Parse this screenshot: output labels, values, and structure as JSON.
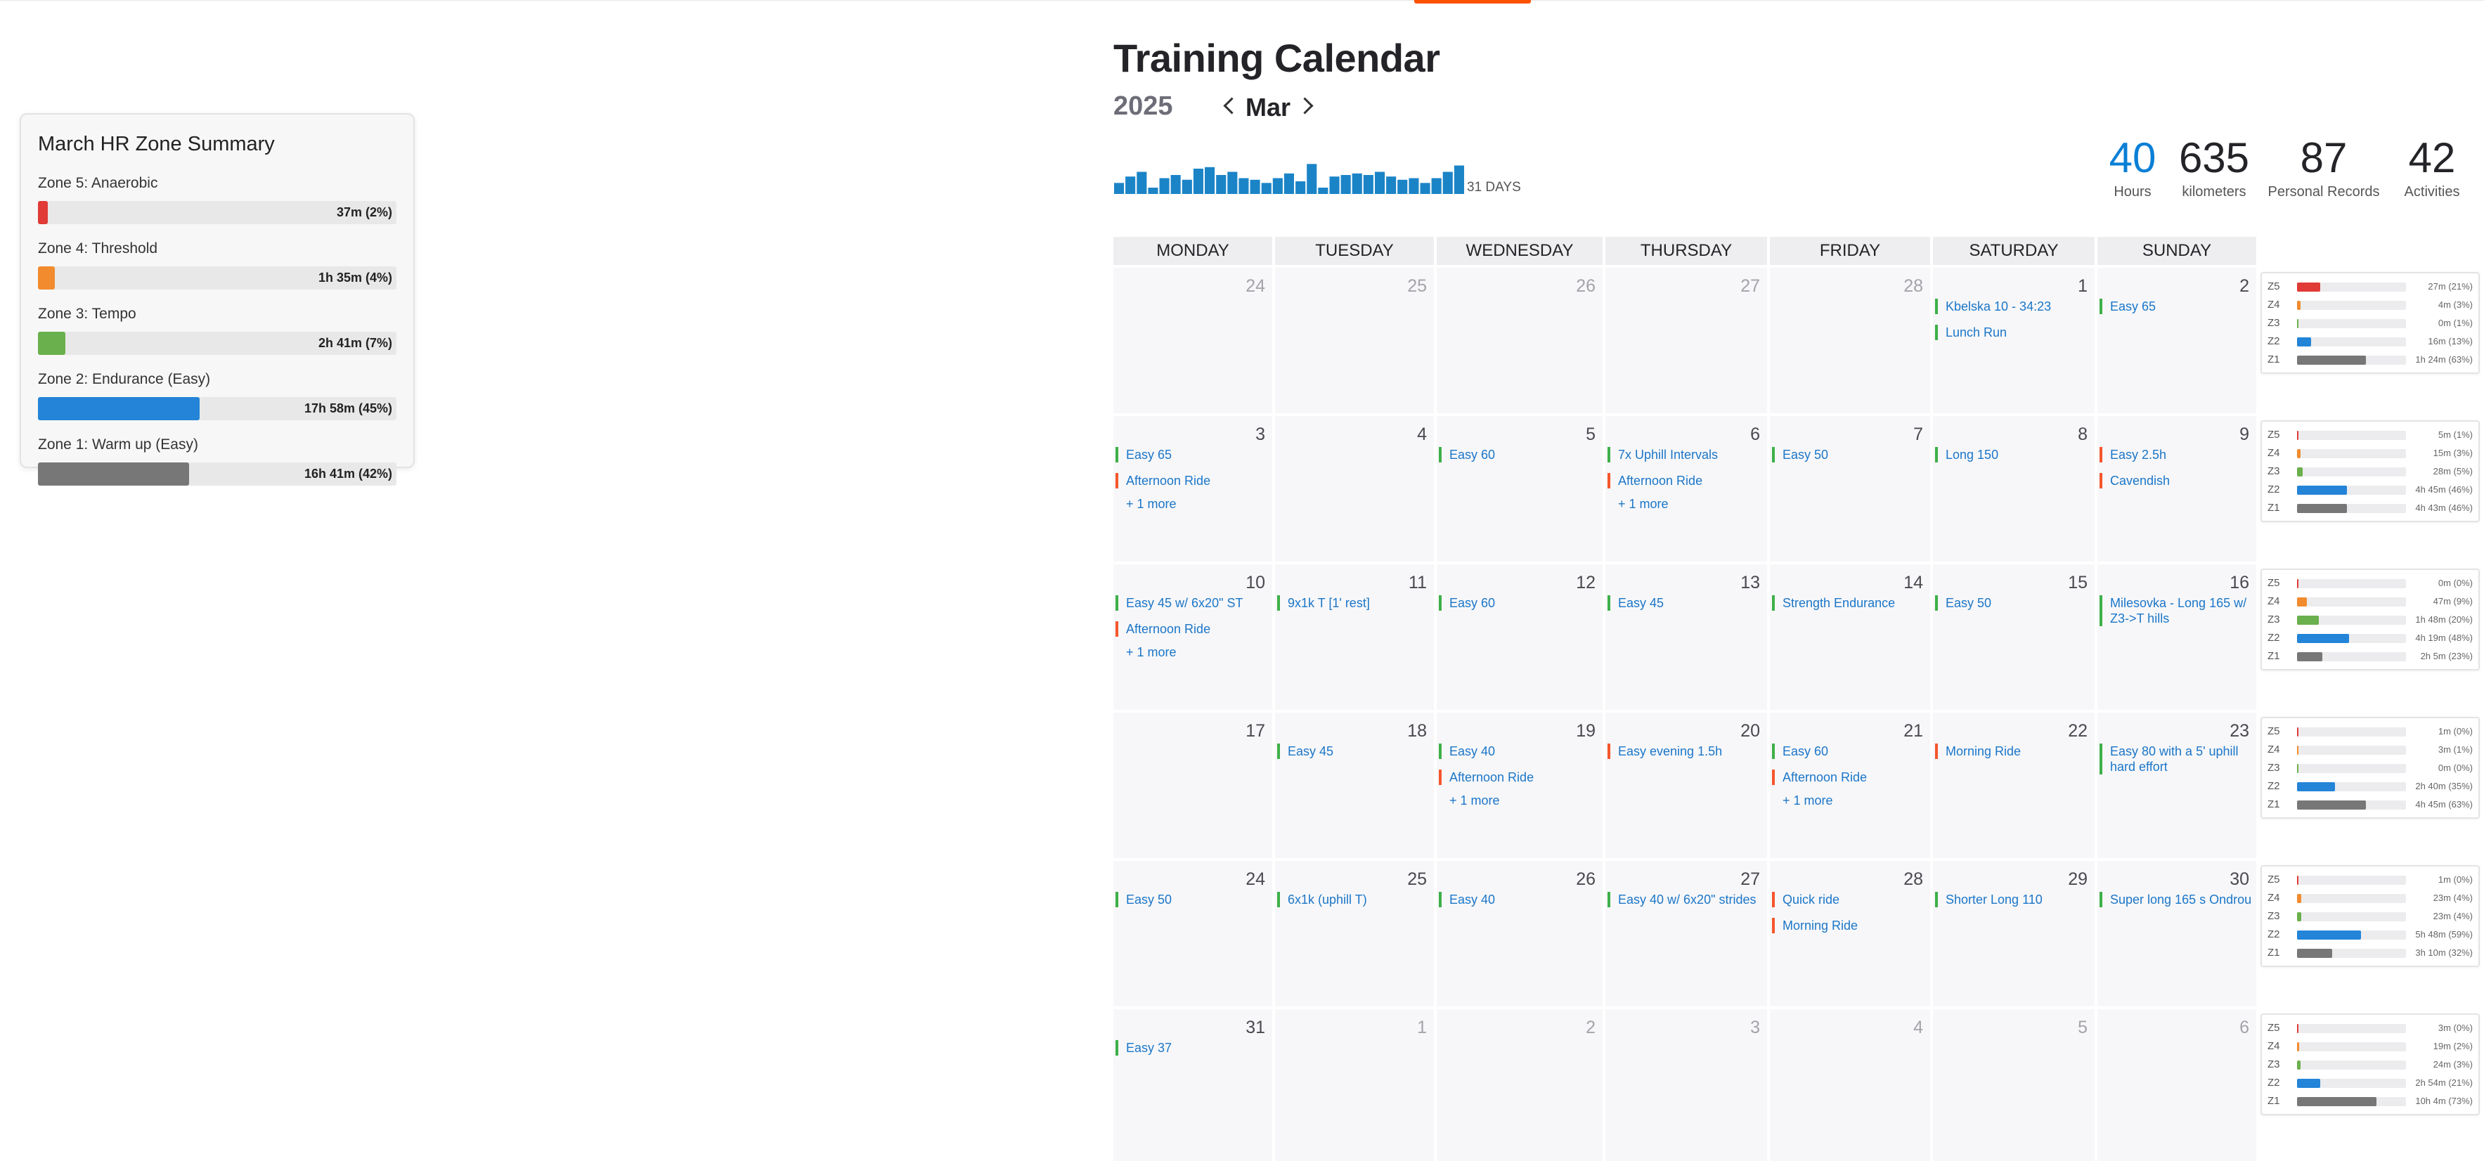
{
  "zone_summary": {
    "title": "March HR Zone Summary",
    "zones": [
      {
        "label": "Zone 5: Anaerobic",
        "value": "37m (2%)",
        "fraction": 0.02,
        "color": "#e03b36"
      },
      {
        "label": "Zone 4: Threshold",
        "value": "1h 35m (4%)",
        "fraction": 0.04,
        "color": "#f28b2e"
      },
      {
        "label": "Zone 3: Tempo",
        "value": "2h 41m (7%)",
        "fraction": 0.07,
        "color": "#6ab04c"
      },
      {
        "label": "Zone 2: Endurance (Easy)",
        "value": "17h 58m (45%)",
        "fraction": 0.45,
        "color": "#2384d8"
      },
      {
        "label": "Zone 1: Warm up (Easy)",
        "value": "16h 41m (42%)",
        "fraction": 0.42,
        "color": "#777777"
      }
    ]
  },
  "header": {
    "title": "Training Calendar",
    "year": "2025",
    "month": "Mar",
    "days_label": "31 DAYS",
    "spark_color": "#1b84c7",
    "spark_values": [
      0.35,
      0.55,
      0.7,
      0.2,
      0.5,
      0.6,
      0.45,
      0.8,
      0.85,
      0.6,
      0.7,
      0.5,
      0.45,
      0.35,
      0.5,
      0.65,
      0.4,
      0.95,
      0.2,
      0.55,
      0.6,
      0.65,
      0.6,
      0.7,
      0.55,
      0.45,
      0.5,
      0.35,
      0.5,
      0.7,
      0.9
    ]
  },
  "stats": [
    {
      "value": "40",
      "label": "Hours"
    },
    {
      "value": "635",
      "label": "kilometers"
    },
    {
      "value": "87",
      "label": "Personal Records"
    },
    {
      "value": "42",
      "label": "Activities"
    }
  ],
  "calendar": {
    "weekdays": [
      "MONDAY",
      "TUESDAY",
      "WEDNESDAY",
      "THURSDAY",
      "FRIDAY",
      "SATURDAY",
      "SUNDAY"
    ],
    "weeks": [
      {
        "days": [
          {
            "num": "24",
            "other": true,
            "acts": []
          },
          {
            "num": "25",
            "other": true,
            "acts": []
          },
          {
            "num": "26",
            "other": true,
            "acts": []
          },
          {
            "num": "27",
            "other": true,
            "acts": []
          },
          {
            "num": "28",
            "other": true,
            "acts": []
          },
          {
            "num": "1",
            "acts": [
              {
                "t": "Kbelska 10 - 34:23",
                "c": "green"
              },
              {
                "t": "Lunch Run",
                "c": "green"
              }
            ]
          },
          {
            "num": "2",
            "acts": [
              {
                "t": "Easy 65",
                "c": "green"
              }
            ]
          }
        ]
      },
      {
        "days": [
          {
            "num": "3",
            "acts": [
              {
                "t": "Easy 65",
                "c": "green"
              },
              {
                "t": "Afternoon Ride",
                "c": "orange"
              }
            ],
            "more": "+ 1 more"
          },
          {
            "num": "4",
            "acts": []
          },
          {
            "num": "5",
            "acts": [
              {
                "t": "Easy 60",
                "c": "green"
              }
            ]
          },
          {
            "num": "6",
            "acts": [
              {
                "t": "7x Uphill Intervals",
                "c": "green"
              },
              {
                "t": "Afternoon Ride",
                "c": "orange"
              }
            ],
            "more": "+ 1 more"
          },
          {
            "num": "7",
            "acts": [
              {
                "t": "Easy 50",
                "c": "green"
              }
            ]
          },
          {
            "num": "8",
            "acts": [
              {
                "t": "Long 150",
                "c": "green"
              }
            ]
          },
          {
            "num": "9",
            "acts": [
              {
                "t": "Easy 2.5h",
                "c": "orange"
              },
              {
                "t": "Cavendish",
                "c": "orange"
              }
            ]
          }
        ]
      },
      {
        "days": [
          {
            "num": "10",
            "acts": [
              {
                "t": "Easy 45 w/ 6x20\" ST",
                "c": "green"
              },
              {
                "t": "Afternoon Ride",
                "c": "orange"
              }
            ],
            "more": "+ 1 more"
          },
          {
            "num": "11",
            "acts": [
              {
                "t": "9x1k T [1' rest]",
                "c": "green"
              }
            ]
          },
          {
            "num": "12",
            "acts": [
              {
                "t": "Easy 60",
                "c": "green"
              }
            ]
          },
          {
            "num": "13",
            "acts": [
              {
                "t": "Easy 45",
                "c": "green"
              }
            ]
          },
          {
            "num": "14",
            "acts": [
              {
                "t": "Strength Endurance",
                "c": "green"
              }
            ]
          },
          {
            "num": "15",
            "acts": [
              {
                "t": "Easy 50",
                "c": "green"
              }
            ]
          },
          {
            "num": "16",
            "acts": [
              {
                "t": "Milesovka - Long 165 w/ Z3->T hills",
                "c": "green",
                "two": true
              }
            ]
          }
        ]
      },
      {
        "days": [
          {
            "num": "17",
            "acts": []
          },
          {
            "num": "18",
            "acts": [
              {
                "t": "Easy 45",
                "c": "green"
              }
            ]
          },
          {
            "num": "19",
            "acts": [
              {
                "t": "Easy 40",
                "c": "green"
              },
              {
                "t": "Afternoon Ride",
                "c": "orange"
              }
            ],
            "more": "+ 1 more"
          },
          {
            "num": "20",
            "acts": [
              {
                "t": "Easy evening 1.5h",
                "c": "orange"
              }
            ]
          },
          {
            "num": "21",
            "acts": [
              {
                "t": "Easy 60",
                "c": "green"
              },
              {
                "t": "Afternoon Ride",
                "c": "orange"
              }
            ],
            "more": "+ 1 more"
          },
          {
            "num": "22",
            "acts": [
              {
                "t": "Morning Ride",
                "c": "orange"
              }
            ]
          },
          {
            "num": "23",
            "acts": [
              {
                "t": "Easy 80 with a 5' uphill hard effort",
                "c": "green",
                "two": true
              }
            ]
          }
        ]
      },
      {
        "days": [
          {
            "num": "24",
            "acts": [
              {
                "t": "Easy 50",
                "c": "green"
              }
            ]
          },
          {
            "num": "25",
            "acts": [
              {
                "t": "6x1k (uphill T)",
                "c": "green"
              }
            ]
          },
          {
            "num": "26",
            "acts": [
              {
                "t": "Easy 40",
                "c": "green"
              }
            ]
          },
          {
            "num": "27",
            "acts": [
              {
                "t": "Easy 40 w/ 6x20\" strides",
                "c": "green"
              }
            ]
          },
          {
            "num": "28",
            "acts": [
              {
                "t": "Quick ride",
                "c": "orange"
              },
              {
                "t": "Morning Ride",
                "c": "orange"
              }
            ]
          },
          {
            "num": "29",
            "acts": [
              {
                "t": "Shorter Long 110",
                "c": "green"
              }
            ]
          },
          {
            "num": "30",
            "acts": [
              {
                "t": "Super long 165 s Ondrou",
                "c": "green"
              }
            ]
          }
        ]
      },
      {
        "days": [
          {
            "num": "31",
            "acts": [
              {
                "t": "Easy 37",
                "c": "green"
              }
            ]
          },
          {
            "num": "1",
            "other": true,
            "acts": []
          },
          {
            "num": "2",
            "other": true,
            "acts": []
          },
          {
            "num": "3",
            "other": true,
            "acts": []
          },
          {
            "num": "4",
            "other": true,
            "acts": []
          },
          {
            "num": "5",
            "other": true,
            "acts": []
          },
          {
            "num": "6",
            "other": true,
            "acts": []
          }
        ]
      }
    ]
  },
  "weekly_zones": [
    [
      {
        "z": "Z5",
        "v": "27m (21%)",
        "f": 0.21
      },
      {
        "z": "Z4",
        "v": "4m (3%)",
        "f": 0.03
      },
      {
        "z": "Z3",
        "v": "0m (1%)",
        "f": 0.01
      },
      {
        "z": "Z2",
        "v": "16m (13%)",
        "f": 0.13
      },
      {
        "z": "Z1",
        "v": "1h 24m (63%)",
        "f": 0.63
      }
    ],
    [
      {
        "z": "Z5",
        "v": "5m (1%)",
        "f": 0.01
      },
      {
        "z": "Z4",
        "v": "15m (3%)",
        "f": 0.03
      },
      {
        "z": "Z3",
        "v": "28m (5%)",
        "f": 0.05
      },
      {
        "z": "Z2",
        "v": "4h 45m (46%)",
        "f": 0.46
      },
      {
        "z": "Z1",
        "v": "4h 43m (46%)",
        "f": 0.46
      }
    ],
    [
      {
        "z": "Z5",
        "v": "0m (0%)",
        "f": 0.0
      },
      {
        "z": "Z4",
        "v": "47m (9%)",
        "f": 0.09
      },
      {
        "z": "Z3",
        "v": "1h 48m (20%)",
        "f": 0.2
      },
      {
        "z": "Z2",
        "v": "4h 19m (48%)",
        "f": 0.48
      },
      {
        "z": "Z1",
        "v": "2h 5m (23%)",
        "f": 0.23
      }
    ],
    [
      {
        "z": "Z5",
        "v": "1m (0%)",
        "f": 0.0
      },
      {
        "z": "Z4",
        "v": "3m (1%)",
        "f": 0.01
      },
      {
        "z": "Z3",
        "v": "0m (0%)",
        "f": 0.0
      },
      {
        "z": "Z2",
        "v": "2h 40m (35%)",
        "f": 0.35
      },
      {
        "z": "Z1",
        "v": "4h 45m (63%)",
        "f": 0.63
      }
    ],
    [
      {
        "z": "Z5",
        "v": "1m (0%)",
        "f": 0.0
      },
      {
        "z": "Z4",
        "v": "23m (4%)",
        "f": 0.04
      },
      {
        "z": "Z3",
        "v": "23m (4%)",
        "f": 0.04
      },
      {
        "z": "Z2",
        "v": "5h 48m (59%)",
        "f": 0.59
      },
      {
        "z": "Z1",
        "v": "3h 10m (32%)",
        "f": 0.32
      }
    ],
    [
      {
        "z": "Z5",
        "v": "3m (0%)",
        "f": 0.0
      },
      {
        "z": "Z4",
        "v": "19m (2%)",
        "f": 0.02
      },
      {
        "z": "Z3",
        "v": "24m (3%)",
        "f": 0.03
      },
      {
        "z": "Z2",
        "v": "2h 54m (21%)",
        "f": 0.21
      },
      {
        "z": "Z1",
        "v": "10h 4m (73%)",
        "f": 0.73
      }
    ]
  ],
  "zone_colors": {
    "Z5": "#e03b36",
    "Z4": "#f28b2e",
    "Z3": "#6ab04c",
    "Z2": "#2384d8",
    "Z1": "#777777"
  }
}
